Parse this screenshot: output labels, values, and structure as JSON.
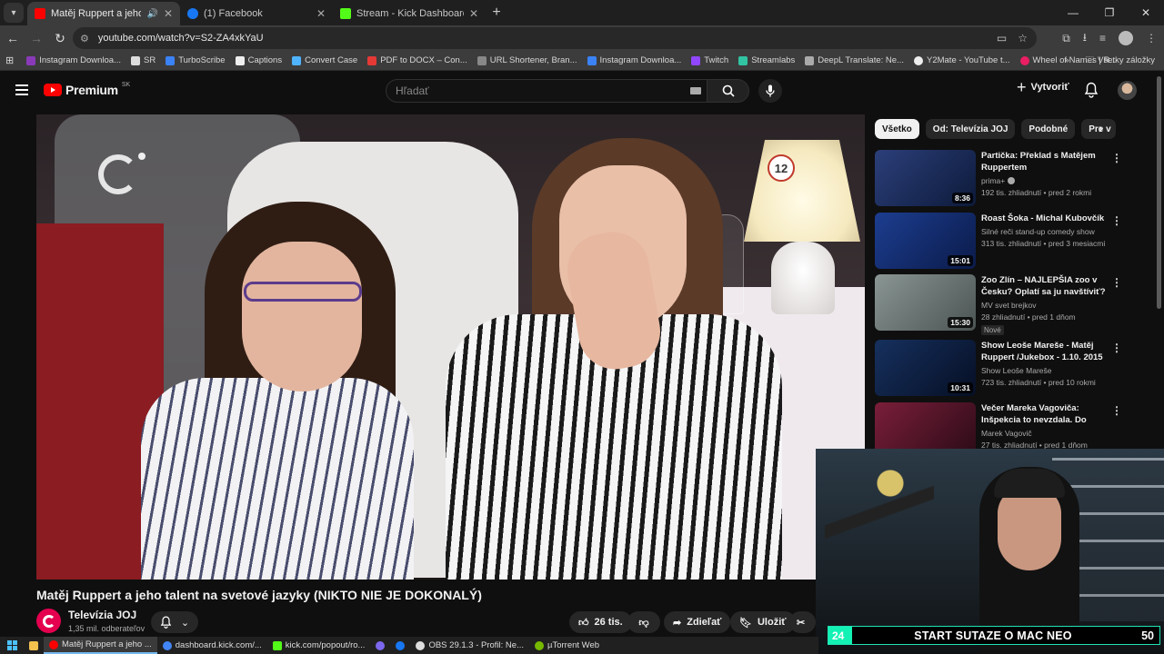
{
  "browser": {
    "tabs": [
      {
        "title": "Matěj Ruppert a jeho talent na svetové jazyky",
        "color": "#ff0000",
        "active": true
      },
      {
        "title": "(1) Facebook",
        "color": "#1877f2",
        "active": false
      },
      {
        "title": "Stream - Kick Dashboard",
        "color": "#53fc18",
        "active": false
      }
    ],
    "url": "youtube.com/watch?v=S2-ZA4xkYaU",
    "bookmarks": [
      {
        "label": "Instagram Downloa...",
        "color": "#8a3ab9"
      },
      {
        "label": "SR",
        "color": "#dddddd"
      },
      {
        "label": "TurboScribe",
        "color": "#3b82f6"
      },
      {
        "label": "Captions",
        "color": "#eeeeee"
      },
      {
        "label": "Convert Case",
        "color": "#4fb3ff"
      },
      {
        "label": "PDF to DOCX – Con...",
        "color": "#e53935"
      },
      {
        "label": "URL Shortener, Bran...",
        "color": "#888888"
      },
      {
        "label": "Instagram Downloa...",
        "color": "#3b82f6"
      },
      {
        "label": "Twitch",
        "color": "#9146ff"
      },
      {
        "label": "Streamlabs",
        "color": "#31c3a2"
      },
      {
        "label": "DeepL Translate: Ne...",
        "color": "#aaaaaa"
      },
      {
        "label": "Y2Mate - YouTube t...",
        "color": "#eeeeee"
      },
      {
        "label": "Wheel of Names | R...",
        "color": "#e91e63"
      }
    ],
    "all_bookmarks": "Všetky záložky"
  },
  "youtube": {
    "logo_text": "Premium",
    "country": "SK",
    "search_placeholder": "Hľadať",
    "create_label": "Vytvoriť",
    "video": {
      "title": "Matěj Ruppert a jeho talent na svetové jazyky (NIKTO NIE JE DOKONALÝ)",
      "overlay_number": "12",
      "channel": "Televízia JOJ",
      "subscribers": "1,35 mil. odberateľov",
      "likes": "26 tis.",
      "share_label": "Zdieľať",
      "save_label": "Uložiť"
    },
    "chips": [
      "Všetko",
      "Od: Televízia JOJ",
      "Podobné",
      "Pre v"
    ],
    "recommendations": [
      {
        "title": "Partička: Překlad s Matějem Ruppertem",
        "channel": "prima+",
        "meta": "192 tis. zhliadnutí • pred 2 rokmi",
        "duration": "8:36",
        "badge": "",
        "thumb_color": "#2b3f7a"
      },
      {
        "title": "Roast Šoka - Michal Kubovčík",
        "channel": "Silné reči stand-up comedy show",
        "meta": "313 tis. zhliadnutí • pred 3 mesiacmi",
        "duration": "15:01",
        "badge": "",
        "thumb_color": "#1c3d8f"
      },
      {
        "title": "Zoo Zlín – NAJLEPŠIA zoo v Česku? Oplatí sa ju navštíviť? ...",
        "channel": "MV svet brejkov",
        "meta": "28 zhliadnutí • pred 1 dňom",
        "duration": "15:30",
        "badge": "Nové",
        "thumb_color": "#6f7a78"
      },
      {
        "title": "Show Leoše Mareše - Matěj Ruppert  /Jukebox - 1.10. 2015",
        "channel": "Show Leoše Mareše",
        "meta": "723 tis. zhliadnutí • pred 10 rokmi",
        "duration": "10:31",
        "badge": "",
        "thumb_color": "#16305e"
      },
      {
        "title": "Večer Mareka Vagoviča: Inšpekcia to nevzdala. Do voli...",
        "channel": "Marek Vagovič",
        "meta": "27 tis. zhliadnutí • pred 1 dňom",
        "duration": "",
        "badge": "",
        "thumb_color": "#7a1e3a"
      }
    ]
  },
  "stream_overlay": {
    "left_number": "24",
    "banner": "START SUTAZE O MAC NEO",
    "right_number": "50",
    "accent": "#13f1b4"
  },
  "taskbar": {
    "items": [
      {
        "label": "Matěj Ruppert a jeho ...",
        "color": "#ff0000",
        "active": true
      },
      {
        "label": "dashboard.kick.com/...",
        "color": "#4285f4",
        "active": false
      },
      {
        "label": "kick.com/popout/ro...",
        "color": "#53fc18",
        "active": false
      },
      {
        "label": "",
        "color": "#7b68ee",
        "active": false
      },
      {
        "label": "",
        "color": "#1877f2",
        "active": false
      },
      {
        "label": "OBS 29.1.3 - Profil: Ne...",
        "color": "#dddddd",
        "active": false
      },
      {
        "label": "µTorrent Web",
        "color": "#76b900",
        "active": false
      }
    ]
  }
}
